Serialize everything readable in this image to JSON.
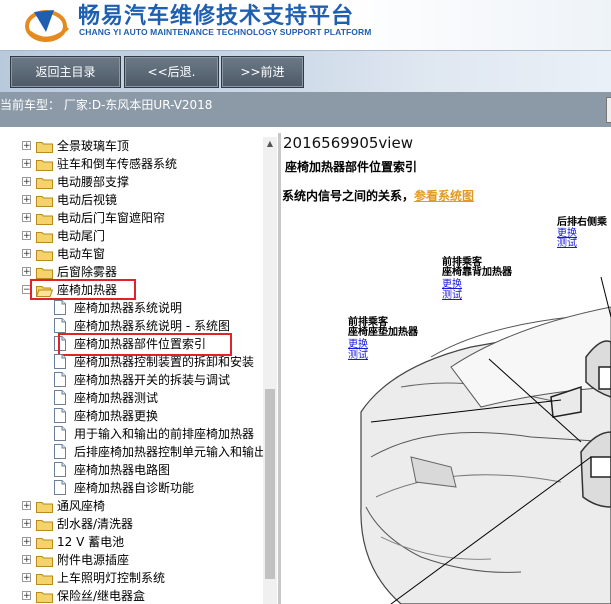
{
  "header": {
    "title": "畅易汽车维修技术支持平台",
    "subtitle": "CHANG YI AUTO MAINTENANCE TECHNOLOGY SUPPORT PLATFORM",
    "brand_color": "#1f5fb0"
  },
  "toolbar": {
    "home_label": "返回主目录",
    "back_label": "<<后退.",
    "forward_label": ">>前进"
  },
  "model_bar": {
    "text": "当前车型： 厂家:D-东风本田UR-V2018"
  },
  "tree": {
    "items": [
      {
        "label": "全景玻璃车顶",
        "type": "folder",
        "expanded": false
      },
      {
        "label": "驻车和倒车传感器系统",
        "type": "folder",
        "expanded": false
      },
      {
        "label": "电动腰部支撑",
        "type": "folder",
        "expanded": false
      },
      {
        "label": "电动后视镜",
        "type": "folder",
        "expanded": false
      },
      {
        "label": "电动后门车窗遮阳帘",
        "type": "folder",
        "expanded": false
      },
      {
        "label": "电动尾门",
        "type": "folder",
        "expanded": false
      },
      {
        "label": "电动车窗",
        "type": "folder",
        "expanded": false
      },
      {
        "label": "后窗除雾器",
        "type": "folder",
        "expanded": false
      },
      {
        "label": "座椅加热器",
        "type": "folder",
        "expanded": true,
        "highlighted": true
      },
      {
        "label": "座椅加热器系统说明",
        "type": "page"
      },
      {
        "label": "座椅加热器系统说明 - 系统图",
        "type": "page"
      },
      {
        "label": "座椅加热器部件位置索引",
        "type": "page",
        "highlighted": true
      },
      {
        "label": "座椅加热器控制装置的拆卸和安装",
        "type": "page"
      },
      {
        "label": "座椅加热器开关的拆装与调试",
        "type": "page"
      },
      {
        "label": "座椅加热器测试",
        "type": "page"
      },
      {
        "label": "座椅加热器更换",
        "type": "page"
      },
      {
        "label": "用于输入和输出的前排座椅加热器",
        "type": "page"
      },
      {
        "label": "后排座椅加热器控制单元输入和输出",
        "type": "page"
      },
      {
        "label": "座椅加热器电路图",
        "type": "page"
      },
      {
        "label": "座椅加热器自诊断功能",
        "type": "page"
      },
      {
        "label": "通风座椅",
        "type": "folder",
        "expanded": false
      },
      {
        "label": "刮水器/清洗器",
        "type": "folder",
        "expanded": false
      },
      {
        "label": "12 V 蓄电池",
        "type": "folder",
        "expanded": false
      },
      {
        "label": "附件电源插座",
        "type": "folder",
        "expanded": false
      },
      {
        "label": "上车照明灯控制系统",
        "type": "folder",
        "expanded": false
      },
      {
        "label": "保险丝/继电器盒",
        "type": "folder",
        "expanded": false
      }
    ]
  },
  "content": {
    "view_id": "2016569905view",
    "doc_title": "座椅加热器部件位置索引",
    "relation_prefix": "系统内信号之间的关系，",
    "relation_link": "参看系统图",
    "callouts": [
      {
        "name1": "后排右侧乘",
        "name2": "",
        "link1": "更换",
        "link2": "测试"
      },
      {
        "name1": "前排乘客",
        "name2": "座椅靠背加热器",
        "link1": "更换",
        "link2": "测试"
      },
      {
        "name1": "前排乘客",
        "name2": "座椅座垫加热器",
        "link1": "更换",
        "link2": "测试"
      }
    ]
  },
  "colors": {
    "highlight_border": "#e0232b",
    "link": "#1a1adb",
    "system_link": "#e39a25",
    "model_bar": "#8c9aa8"
  }
}
